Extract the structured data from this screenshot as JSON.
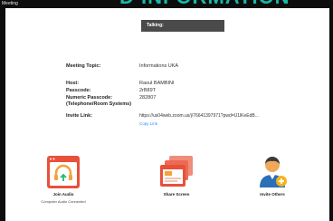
{
  "window": {
    "title": "Meeting"
  },
  "background_banner": "D INFORMATION",
  "talking": {
    "label": "Talking:"
  },
  "meeting": {
    "topic_label": "Meeting Topic:",
    "topic_value": "Informations UKA",
    "host_label": "Host:",
    "host_value": "Raoul BAMBINI",
    "passcode_label": "Passcode:",
    "passcode_value": "2rB89T",
    "numeric_label_1": "Numeric Passcode:",
    "numeric_label_2": "(Telephone/Room Systems)",
    "numeric_value": "282807",
    "invite_label": "Invite Link:",
    "invite_value": "https://us04web.zoom.us/j/76641397971?pwd=U1lKeEdB...",
    "copy_link": "Copy Link"
  },
  "actions": [
    {
      "label": "Join Audio",
      "sub": "Computer Audio Connected",
      "icon": "headphones-icon"
    },
    {
      "label": "Share Screen",
      "sub": "",
      "icon": "share-screen-icon"
    },
    {
      "label": "Invite Others",
      "sub": "",
      "icon": "invite-person-icon"
    }
  ],
  "colors": {
    "accent": "#e8503a",
    "link": "#2d8cff",
    "banner": "#18b8a8"
  }
}
